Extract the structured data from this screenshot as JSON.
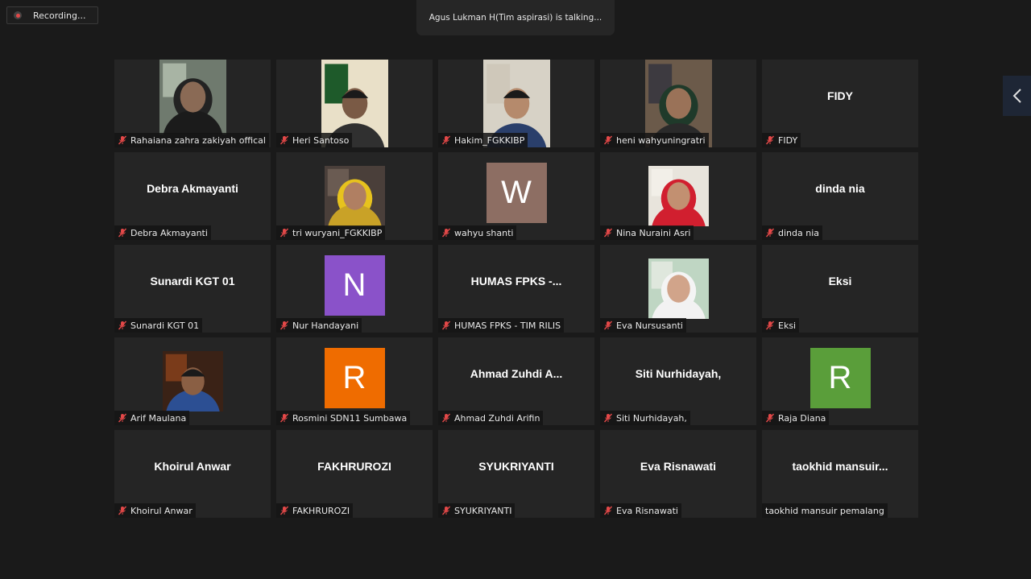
{
  "recording": {
    "label": "Recording..."
  },
  "talking": {
    "text": "Agus Lukman H(Tim aspirasi) is talking..."
  },
  "colors": {
    "background": "#1a1a1a",
    "tile": "#252525",
    "mute": "#e34848"
  },
  "participants": [
    {
      "name": "Rahaiana zahra zakiyah offical",
      "kind": "video",
      "muted": true
    },
    {
      "name": "Heri Santoso",
      "kind": "video",
      "muted": true
    },
    {
      "name": "Hakim_FGKKIBP",
      "kind": "video",
      "muted": true
    },
    {
      "name": "heni wahyuningratri",
      "kind": "video",
      "muted": true
    },
    {
      "name": "FIDY",
      "display": "FIDY",
      "kind": "name",
      "muted": true
    },
    {
      "name": "Debra Akmayanti",
      "display": "Debra Akmayanti",
      "kind": "name",
      "muted": true
    },
    {
      "name": "tri wuryani_FGKKIBP",
      "kind": "video",
      "muted": true
    },
    {
      "name": "wahyu shanti",
      "initial": "W",
      "avatar_color": "#8d6e63",
      "kind": "avatar",
      "muted": true
    },
    {
      "name": "Nina Nuraini Asri",
      "kind": "video",
      "muted": true
    },
    {
      "name": "dinda nia",
      "display": "dinda nia",
      "kind": "name",
      "muted": true
    },
    {
      "name": "Sunardi KGT 01",
      "display": "Sunardi KGT 01",
      "kind": "name",
      "muted": true
    },
    {
      "name": "Nur Handayani",
      "initial": "N",
      "avatar_color": "#8a52c9",
      "kind": "avatar",
      "muted": true
    },
    {
      "name": "HUMAS FPKS - TIM RILIS",
      "display": "HUMAS FPKS -...",
      "kind": "name",
      "muted": true
    },
    {
      "name": "Eva Nursusanti",
      "kind": "video",
      "muted": true
    },
    {
      "name": "Eksi",
      "display": "Eksi",
      "kind": "name",
      "muted": true
    },
    {
      "name": "Arif Maulana",
      "kind": "video",
      "muted": true
    },
    {
      "name": "Rosmini SDN11 Sumbawa",
      "initial": "R",
      "avatar_color": "#ef6c00",
      "kind": "avatar",
      "muted": true
    },
    {
      "name": "Ahmad Zuhdi Arifin",
      "display": "Ahmad Zuhdi A...",
      "kind": "name",
      "muted": true
    },
    {
      "name": "Siti Nurhidayah,",
      "display": "Siti Nurhidayah,",
      "kind": "name",
      "muted": true
    },
    {
      "name": "Raja Diana",
      "initial": "R",
      "avatar_color": "#5a9e3a",
      "kind": "avatar",
      "muted": true
    },
    {
      "name": "Khoirul Anwar",
      "display": "Khoirul Anwar",
      "kind": "name",
      "muted": true
    },
    {
      "name": "FAKHRUROZI",
      "display": "FAKHRUROZI",
      "kind": "name",
      "muted": true
    },
    {
      "name": "SYUKRIYANTI",
      "display": "SYUKRIYANTI",
      "kind": "name",
      "muted": true
    },
    {
      "name": "Eva Risnawati",
      "display": "Eva Risnawati",
      "kind": "name",
      "muted": true
    },
    {
      "name": "taokhid mansuir pemalang",
      "display": "taokhid  mansuir...",
      "kind": "name",
      "muted": false
    }
  ]
}
